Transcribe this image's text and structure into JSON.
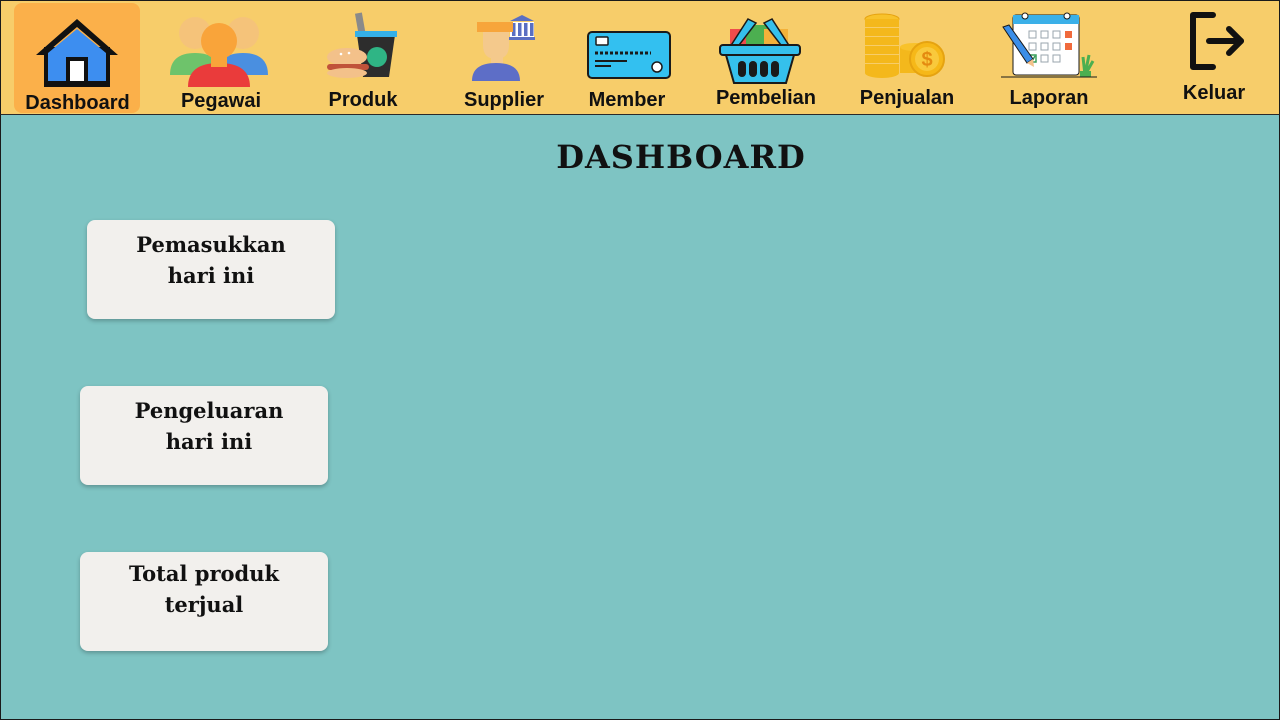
{
  "nav": {
    "dashboard": "Dashboard",
    "pegawai": "Pegawai",
    "produk": "Produk",
    "supplier": "Supplier",
    "member": "Member",
    "pembelian": "Pembelian",
    "penjualan": "Penjualan",
    "laporan": "Laporan",
    "keluar": "Keluar"
  },
  "icons": {
    "dashboard": "house-icon",
    "pegawai": "employees-icon",
    "produk": "food-drink-icon",
    "supplier": "supplier-person-icon",
    "member": "member-card-icon",
    "pembelian": "shopping-basket-icon",
    "penjualan": "coins-icon",
    "laporan": "calendar-report-icon",
    "keluar": "logout-icon"
  },
  "page": {
    "title": "DASHBOARD"
  },
  "cards": {
    "income": {
      "line1": "Pemasukkan",
      "line2": "hari ini"
    },
    "expense": {
      "line1": "Pengeluaran",
      "line2": "hari ini"
    },
    "sold": {
      "line1": "Total produk",
      "line2": "terjual"
    }
  },
  "colors": {
    "navbar": "#f7cd6a",
    "active_tab": "#fbb04a",
    "background": "#7ec4c3",
    "card": "#f2f0ed"
  }
}
